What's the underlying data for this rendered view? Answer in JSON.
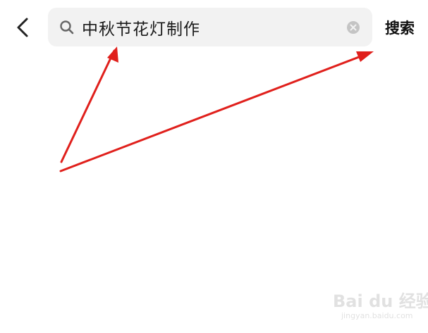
{
  "search": {
    "query": "中秋节花灯制作",
    "button_label": "搜索"
  },
  "icons": {
    "back": "chevron-left-icon",
    "search": "search-icon",
    "clear": "clear-circle-icon"
  },
  "colors": {
    "search_bar_bg": "#f2f2f2",
    "annotation_arrow": "#e0201c",
    "text": "#1a1a1a"
  },
  "watermark": {
    "logo": "Bai du 经验",
    "url": "jingyan.baidu.com"
  }
}
